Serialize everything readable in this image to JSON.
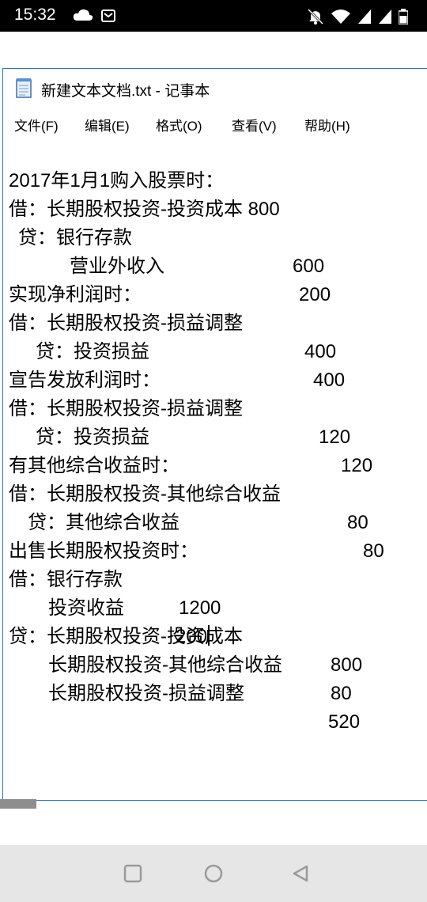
{
  "status_bar": {
    "time": "15:32"
  },
  "window": {
    "title": "新建文本文档.txt - 记事本"
  },
  "menu": [
    "文件(F)",
    "编辑(E)",
    "格式(O)",
    "查看(V)",
    "帮助(H)"
  ],
  "lines": [
    [
      "2017年1月1购入股票时："
    ],
    [
      "借：长期股权投资-投资成本 800"
    ],
    [
      "贷：银行存款",
      "600"
    ],
    [
      "营业外收入",
      "200"
    ],
    [
      "实现净利润时："
    ],
    [
      "借：长期股权投资-损益调整",
      "400"
    ],
    [
      "贷：投资损益",
      "400"
    ],
    [
      "宣告发放利润时："
    ],
    [
      "借：长期股权投资-损益调整",
      "120"
    ],
    [
      "贷：投资损益",
      "120"
    ],
    [
      "有其他综合收益时："
    ],
    [
      "借：长期股权投资-其他综合收益",
      "80"
    ],
    [
      "贷：其他综合收益",
      "80"
    ],
    [
      "出售长期股权投资时："
    ],
    [
      "借：银行存款",
      "1200"
    ],
    [
      "投资收益",
      "200"
    ],
    [
      "贷：长期股权投资-投资成本",
      "800"
    ],
    [
      "长期股权投资-其他综合收益",
      "80"
    ],
    [
      "长期股权投资-损益调整",
      "520"
    ]
  ],
  "colors": {
    "status_bar_bg": "#000000",
    "window_border": "#1b78d0",
    "nav_bar_bg": "#e6e6e6",
    "nav_icon": "#9a9a9a"
  }
}
